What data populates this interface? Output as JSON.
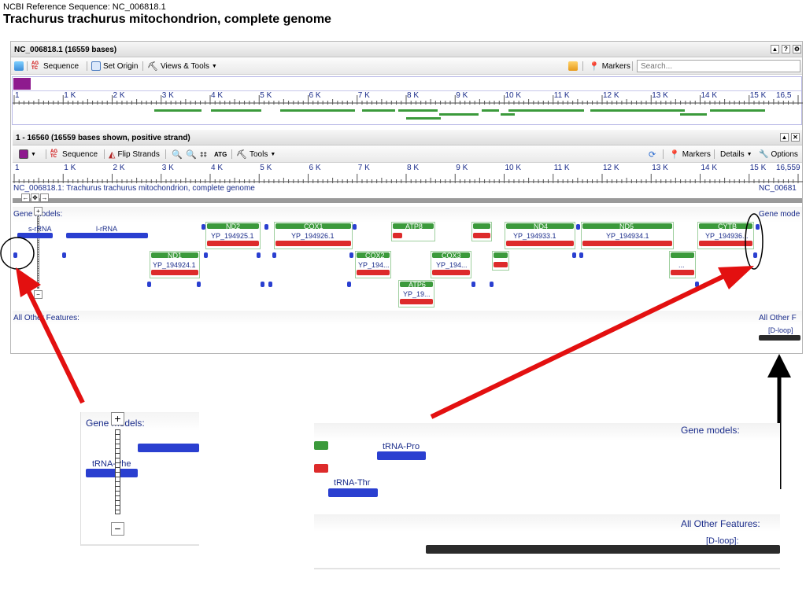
{
  "header": {
    "ref_line": "NCBI Reference Sequence: NC_006818.1",
    "title": "Trachurus trachurus mitochondrion, complete genome"
  },
  "viewer": {
    "title": "NC_006818.1 (16559 bases)",
    "toolbar": {
      "sequence_label": "Sequence",
      "set_origin_label": "Set Origin",
      "views_tools_label": "Views & Tools",
      "markers_label": "Markers",
      "search_placeholder": "Search..."
    },
    "overview_ruler": [
      "1",
      "1 K",
      "2 K",
      "3 K",
      "4 K",
      "5 K",
      "6 K",
      "7 K",
      "8 K",
      "9 K",
      "10 K",
      "11 K",
      "12 K",
      "13 K",
      "14 K",
      "15 K",
      "16,5"
    ],
    "detail": {
      "title": "1 - 16560 (16559 bases shown, positive strand)",
      "toolbar": {
        "sequence_label": "Sequence",
        "flip_strands_label": "Flip Strands",
        "tools_label": "Tools",
        "markers_label": "Markers",
        "details_label": "Details",
        "options_label": "Options"
      },
      "ruler": [
        "1",
        "1 K",
        "2 K",
        "3 K",
        "4 K",
        "5 K",
        "6 K",
        "7 K",
        "8 K",
        "9 K",
        "10 K",
        "11 K",
        "12 K",
        "13 K",
        "14 K",
        "15 K",
        "16,559"
      ],
      "sequence_label_left": "NC_006818.1: Trachurus trachurus mitochondrion, complete genome",
      "sequence_label_right": "NC_00681",
      "gene_models_label": "Gene models:",
      "gene_models_label_right": "Gene mode",
      "all_other_label": "All Other Features:",
      "all_other_label_right": "All Other F",
      "dloop_label": "[D-loop]",
      "genes": {
        "s_rrna": "s-rRNA",
        "l_rrna": "l-rRNA",
        "nd2": "ND2",
        "nd2_protein": "YP_194925.1",
        "cox1": "COX1",
        "cox1_protein": "YP_194926.1",
        "atp8": "ATP8",
        "nd4": "ND4",
        "nd4_protein": "YP_194933.1",
        "nd5": "ND5",
        "nd5_protein": "YP_194934.1",
        "cytb": "CYTB",
        "cytb_protein": "YP_194936...",
        "nd1": "ND1",
        "nd1_protein": "YP_194924.1",
        "cox2": "COX2",
        "cox2_protein": "YP_194...",
        "cox3": "COX3",
        "cox3_protein": "YP_194...",
        "atp6": "ATP6",
        "atp6_protein": "YP_19...",
        "nd6_protein": "..."
      }
    }
  },
  "zoom_left": {
    "label": "Gene models:",
    "trna": "tRNA-Phe"
  },
  "zoom_right": {
    "gene_models_label": "Gene models:",
    "trna_pro": "tRNA-Pro",
    "trna_thr": "tRNA-Thr",
    "all_other_label": "All Other Features:",
    "dloop": "[D-loop]:"
  },
  "colors": {
    "gene_green": "#3b9a3b",
    "protein_red": "#dd2b2b",
    "rna_blue": "#2a3fd0",
    "annotation_arrow": "#e31010"
  }
}
